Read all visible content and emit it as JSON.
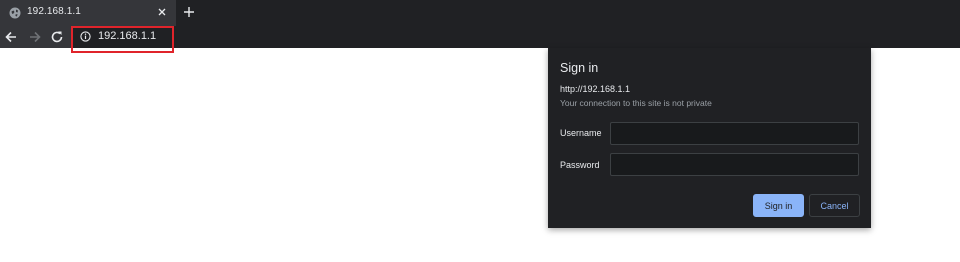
{
  "tab": {
    "title": "192.168.1.1",
    "favicon": "globe-icon",
    "close_icon": "close-icon"
  },
  "toolbar": {
    "back_icon": "arrow-left-icon",
    "forward_icon": "arrow-right-icon",
    "reload_icon": "reload-icon",
    "address": "192.168.1.1",
    "security_icon": "info-icon"
  },
  "dialog": {
    "title": "Sign in",
    "origin": "http://192.168.1.1",
    "warning": "Your connection to this site is not private",
    "username_label": "Username",
    "username_value": "",
    "password_label": "Password",
    "password_value": "",
    "signin_label": "Sign in",
    "cancel_label": "Cancel"
  },
  "colors": {
    "highlight": "#e0242b",
    "primary_button": "#8ab4f8",
    "dialog_bg": "#202124"
  }
}
